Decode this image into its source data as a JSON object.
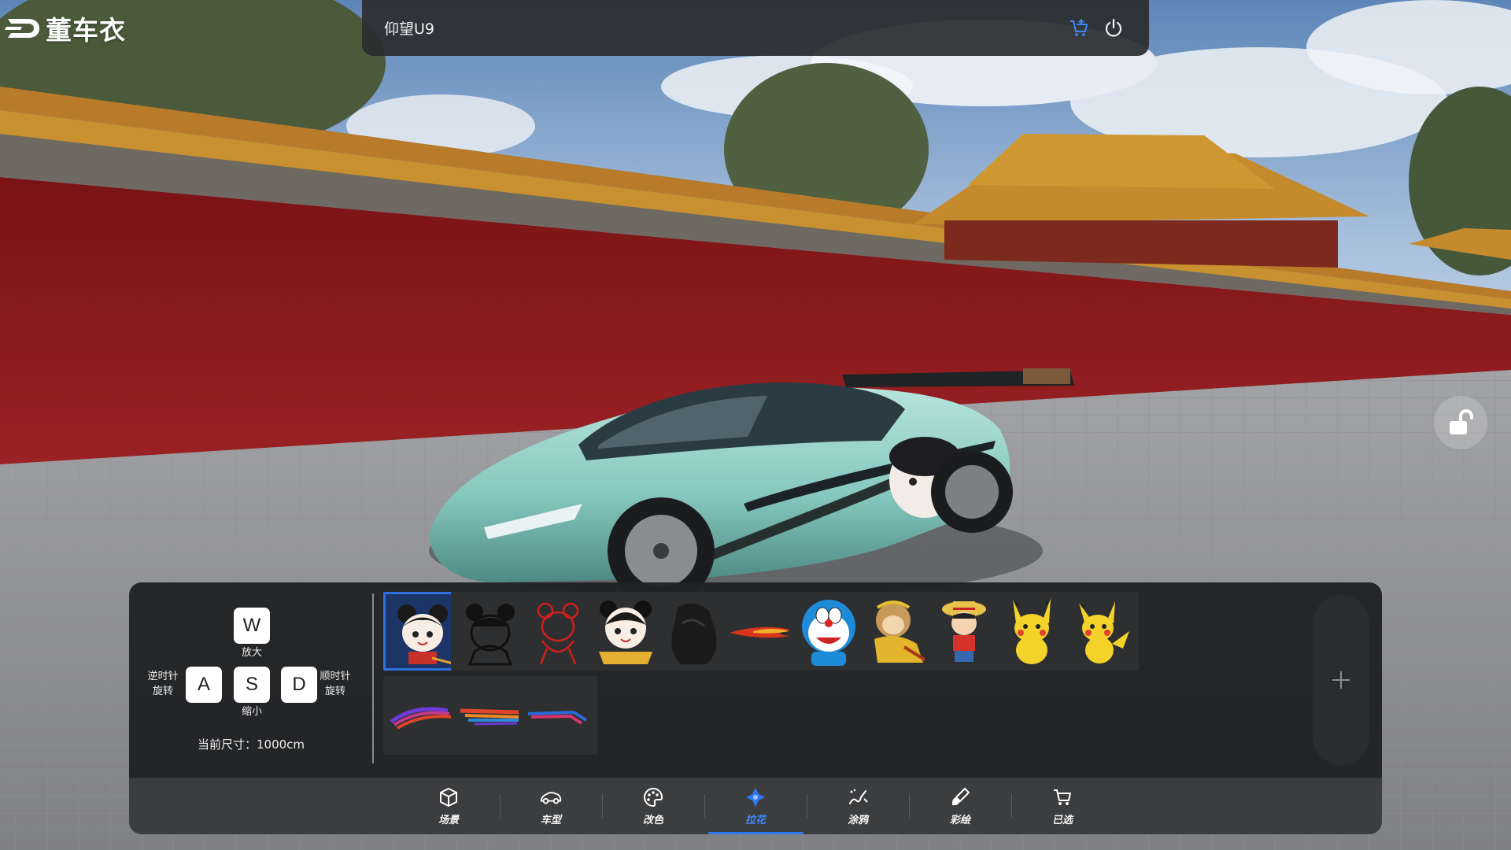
{
  "app": {
    "brand_name": "董车衣",
    "model_name": "仰望U9",
    "icons": [
      "cart-plus-icon",
      "power-icon",
      "unlock-icon",
      "add-icon"
    ]
  },
  "colors": {
    "accent": "#2f78f0",
    "panel_bg": "#202123",
    "nav_bg": "#3a3b3d",
    "wall_red": "#8c1a1d",
    "car_teal": "#8fcfc6"
  },
  "controls": {
    "key_w": "W",
    "key_w_caption": "放大",
    "key_a": "A",
    "key_a_caption": "逆时针旋转",
    "key_s": "S",
    "key_s_caption": "缩小",
    "key_d": "D",
    "key_d_caption": "顺时针旋转",
    "size_label": "当前尺寸：",
    "size_value": "1000cm"
  },
  "decals": [
    {
      "name": "nezha-cartoon",
      "selected": true
    },
    {
      "name": "nezha-sketch",
      "selected": false
    },
    {
      "name": "red-line-figure",
      "selected": false
    },
    {
      "name": "panda-girl-badge",
      "selected": false
    },
    {
      "name": "dark-figure",
      "selected": false
    },
    {
      "name": "flame-streak",
      "selected": false
    },
    {
      "name": "doraemon",
      "selected": false
    },
    {
      "name": "monkey-king",
      "selected": false
    },
    {
      "name": "luffy",
      "selected": false
    },
    {
      "name": "pikachu",
      "selected": false
    },
    {
      "name": "pikachu-2",
      "selected": false
    },
    {
      "name": "stripe-purple-red",
      "selected": false
    },
    {
      "name": "stripe-red-blue",
      "selected": false
    },
    {
      "name": "stripe-blue-red",
      "selected": false
    }
  ],
  "nav": [
    {
      "label": "场景",
      "icon": "scene-cube-icon",
      "active": false
    },
    {
      "label": "车型",
      "icon": "car-icon",
      "active": false
    },
    {
      "label": "改色",
      "icon": "palette-icon",
      "active": false
    },
    {
      "label": "拉花",
      "icon": "decal-flower-icon",
      "active": true
    },
    {
      "label": "涂鸦",
      "icon": "graffiti-icon",
      "active": false
    },
    {
      "label": "彩绘",
      "icon": "paint-brush-icon",
      "active": false
    },
    {
      "label": "已选",
      "icon": "cart-icon",
      "active": false
    }
  ]
}
